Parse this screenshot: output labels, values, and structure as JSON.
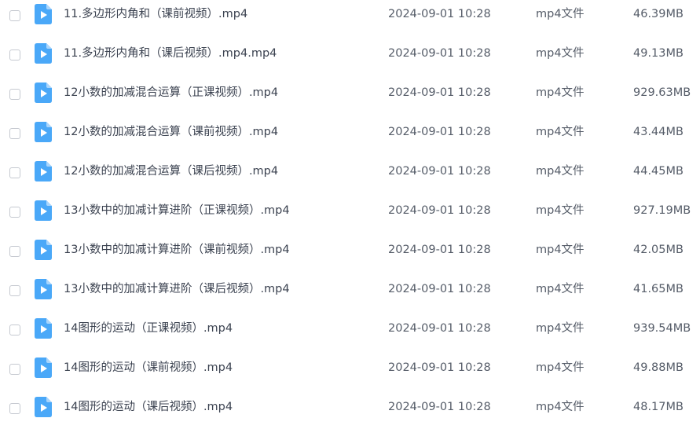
{
  "file_list": {
    "icon": "video-file-icon",
    "icon_color": "#4aa8f8",
    "rows": [
      {
        "name": "11.多边形内角和（课前视频）.mp4",
        "modified": "2024-09-01 10:28",
        "type": "mp4文件",
        "size": "46.39MB"
      },
      {
        "name": "11.多边形内角和（课后视频）.mp4.mp4",
        "modified": "2024-09-01 10:28",
        "type": "mp4文件",
        "size": "49.13MB"
      },
      {
        "name": "12小数的加减混合运算（正课视频）.mp4",
        "modified": "2024-09-01 10:28",
        "type": "mp4文件",
        "size": "929.63MB"
      },
      {
        "name": "12小数的加减混合运算（课前视频）.mp4",
        "modified": "2024-09-01 10:28",
        "type": "mp4文件",
        "size": "43.44MB"
      },
      {
        "name": "12小数的加减混合运算（课后视频）.mp4",
        "modified": "2024-09-01 10:28",
        "type": "mp4文件",
        "size": "44.45MB"
      },
      {
        "name": "13小数中的加减计算进阶（正课视频）.mp4",
        "modified": "2024-09-01 10:28",
        "type": "mp4文件",
        "size": "927.19MB"
      },
      {
        "name": "13小数中的加减计算进阶（课前视频）.mp4",
        "modified": "2024-09-01 10:28",
        "type": "mp4文件",
        "size": "42.05MB"
      },
      {
        "name": "13小数中的加减计算进阶（课后视频）.mp4",
        "modified": "2024-09-01 10:28",
        "type": "mp4文件",
        "size": "41.65MB"
      },
      {
        "name": "14图形的运动（正课视频）.mp4",
        "modified": "2024-09-01 10:28",
        "type": "mp4文件",
        "size": "939.54MB"
      },
      {
        "name": "14图形的运动（课前视频）.mp4",
        "modified": "2024-09-01 10:28",
        "type": "mp4文件",
        "size": "49.88MB"
      },
      {
        "name": "14图形的运动（课后视频）.mp4",
        "modified": "2024-09-01 10:28",
        "type": "mp4文件",
        "size": "48.17MB"
      }
    ]
  }
}
